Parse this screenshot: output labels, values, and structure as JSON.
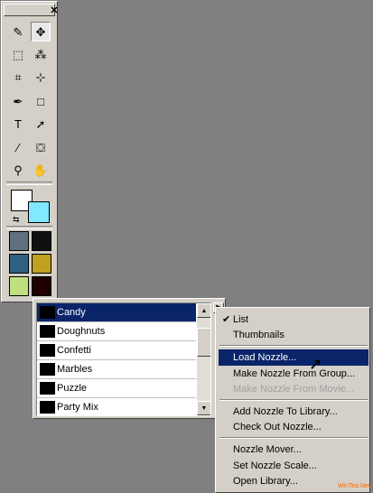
{
  "toolbox": {
    "close_glyph": "✕",
    "tools": [
      {
        "name": "paintbrush-icon",
        "glyph": "✎"
      },
      {
        "name": "mover-icon",
        "glyph": "✥"
      },
      {
        "name": "selection-icon",
        "glyph": "⬚"
      },
      {
        "name": "magic-wand-icon",
        "glyph": "⁂"
      },
      {
        "name": "crop-icon",
        "glyph": "⌗"
      },
      {
        "name": "deform-icon",
        "glyph": "⊹"
      },
      {
        "name": "pen-icon",
        "glyph": "✒"
      },
      {
        "name": "rectangle-icon",
        "glyph": "□"
      },
      {
        "name": "text-icon",
        "glyph": "T"
      },
      {
        "name": "object-selector-icon",
        "glyph": "➚"
      },
      {
        "name": "eyedropper-icon",
        "glyph": "⁄"
      },
      {
        "name": "flood-fill-icon",
        "glyph": "⛋"
      },
      {
        "name": "zoom-icon",
        "glyph": "⚲"
      },
      {
        "name": "pan-hand-icon",
        "glyph": "✋"
      }
    ],
    "swap_glyph": "⇆",
    "brush_colors": [
      "#607080",
      "#101010",
      "#306080",
      "#c0a020",
      "#c0e080",
      "#200000"
    ]
  },
  "nozzle_list": {
    "items": [
      "Candy",
      "Doughnuts",
      "Confetti",
      "Marbles",
      "Puzzle",
      "Party Mix"
    ],
    "selected": "Candy",
    "scroll_up_glyph": "▲",
    "scroll_down_glyph": "▼",
    "menu_button_glyph": "▶"
  },
  "menu": {
    "items": [
      {
        "label": "List",
        "checked": true,
        "state": "normal"
      },
      {
        "label": "Thumbnails",
        "checked": false,
        "state": "normal"
      },
      {
        "label": "Load Nozzle...",
        "checked": false,
        "state": "highlighted"
      },
      {
        "label": "Make Nozzle From Group...",
        "checked": false,
        "state": "normal"
      },
      {
        "label": "Make Nozzle From Movie...",
        "checked": false,
        "state": "disabled"
      },
      {
        "label": "Add Nozzle To Library...",
        "checked": false,
        "state": "normal"
      },
      {
        "label": "Check Out Nozzle...",
        "checked": false,
        "state": "normal"
      },
      {
        "label": "Nozzle Mover...",
        "checked": false,
        "state": "normal"
      },
      {
        "label": "Set Nozzle Scale...",
        "checked": false,
        "state": "normal"
      },
      {
        "label": "Open Library...",
        "checked": false,
        "state": "normal"
      }
    ],
    "check_glyph": "✔"
  },
  "watermark": "WinTea.Net",
  "colors": {
    "face": "#d4d0c8",
    "highlight": "#0a246a",
    "desktop": "#808080",
    "background_swatch": "#80e8ff",
    "foreground_swatch": "#ffffff"
  }
}
